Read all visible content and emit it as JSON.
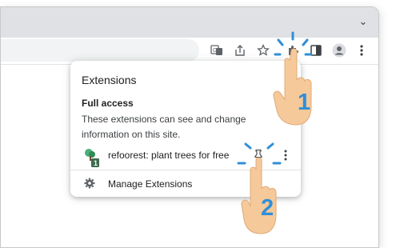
{
  "popup": {
    "title": "Extensions",
    "section_title": "Full access",
    "section_desc": "These extensions can see and change information on this site.",
    "extension_name": "refoorest: plant trees for free",
    "extension_badge": "1",
    "manage_label": "Manage Extensions"
  },
  "annotations": {
    "step1": "1",
    "step2": "2"
  },
  "colors": {
    "accent": "#2f8fd8",
    "hand": "#f5c99a"
  },
  "icons": [
    "translate-icon",
    "share-icon",
    "star-icon",
    "puzzle-icon",
    "side-panel-icon",
    "profile-icon",
    "more-vert-icon",
    "pin-icon",
    "gear-icon"
  ]
}
